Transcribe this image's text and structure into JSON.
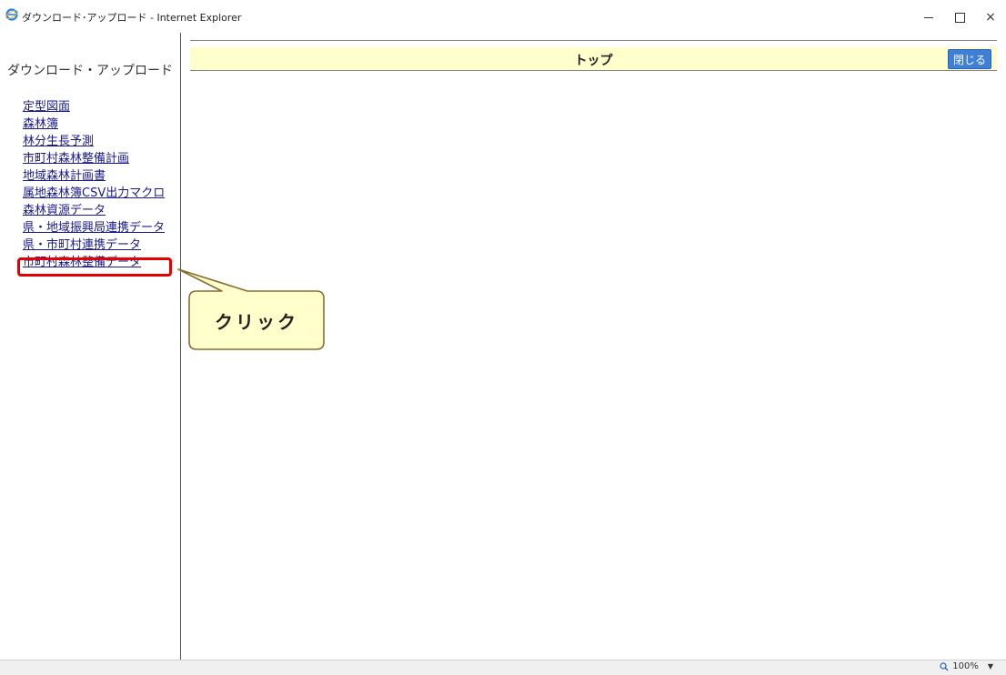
{
  "window": {
    "title": "ダウンロード･アップロード - Internet Explorer",
    "minimize_icon": "minimize-icon",
    "maximize_icon": "maximize-icon",
    "close_label": "×"
  },
  "sidebar": {
    "heading": "ダウンロード・アップロード",
    "items": [
      {
        "label": "定型図面"
      },
      {
        "label": "森林簿"
      },
      {
        "label": "林分生長予測"
      },
      {
        "label": "市町村森林整備計画"
      },
      {
        "label": "地域森林計画書"
      },
      {
        "label": "属地森林簿CSV出力マクロ"
      },
      {
        "label": "森林資源データ"
      },
      {
        "label": "県・地域振興局連携データ"
      },
      {
        "label": "県・市町村連携データ"
      },
      {
        "label": "市町村森林整備データ"
      }
    ],
    "highlighted_index": 8
  },
  "main": {
    "header_title": "トップ",
    "close_button_label": "閉じる"
  },
  "callout": {
    "text": "クリック",
    "fill": "#ffffcc",
    "border": "#8a6d2e"
  },
  "statusbar": {
    "zoom": "100%"
  },
  "colors": {
    "highlight": "#e60000",
    "header_bg": "#ffffcc",
    "close_button_bg": "#3f7fd6",
    "link": "#1a1a8c"
  }
}
